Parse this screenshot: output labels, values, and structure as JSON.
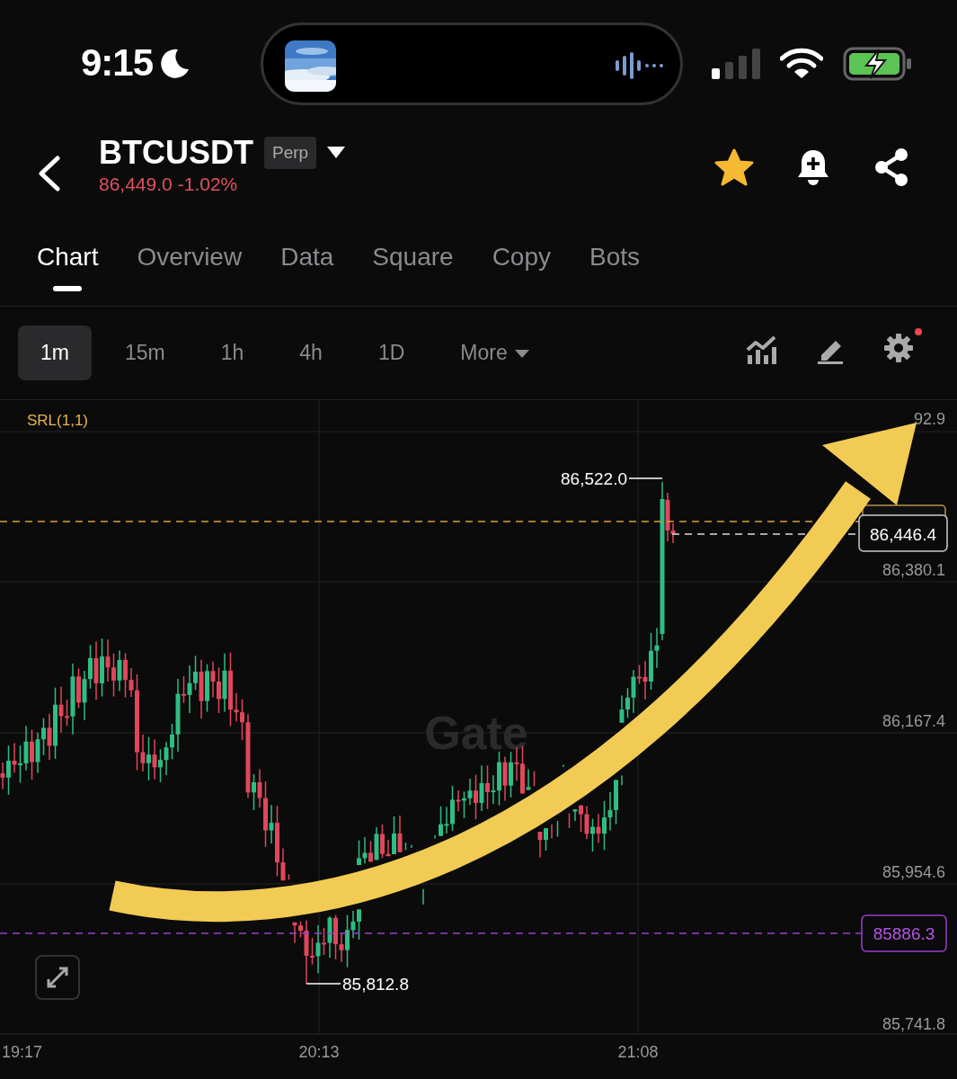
{
  "status_bar": {
    "time": "9:15"
  },
  "header": {
    "symbol": "BTCUSDT",
    "badge": "Perp",
    "price": "86,449.0",
    "change": "-1.02%",
    "favorite": true
  },
  "tabs": [
    {
      "label": "Chart",
      "selected": true
    },
    {
      "label": "Overview",
      "selected": false
    },
    {
      "label": "Data",
      "selected": false
    },
    {
      "label": "Square",
      "selected": false
    },
    {
      "label": "Copy",
      "selected": false
    },
    {
      "label": "Bots",
      "selected": false
    }
  ],
  "timeframes": [
    {
      "label": "1m",
      "kind": "option",
      "selected": true
    },
    {
      "label": "15m",
      "kind": "option",
      "selected": false
    },
    {
      "label": "1h",
      "kind": "option",
      "selected": false
    },
    {
      "label": "4h",
      "kind": "option",
      "selected": false
    },
    {
      "label": "1D",
      "kind": "option",
      "selected": false
    },
    {
      "label": "More",
      "kind": "dropdown",
      "selected": false
    }
  ],
  "toolbar": {
    "settings_badge": true
  },
  "chart": {
    "indicator": "SRL(1,1)",
    "watermark": "Gate",
    "price_ticks": [
      "92.9",
      "86,380.1",
      "86,167.4",
      "85,954.6",
      "85,741.8"
    ],
    "time_ticks": [
      "19:17",
      "20:13",
      "21:08"
    ],
    "high_label": "86,522.0",
    "low_label": "85,812.8",
    "last_price": "86,446.4",
    "line_price": "85886.3"
  }
}
